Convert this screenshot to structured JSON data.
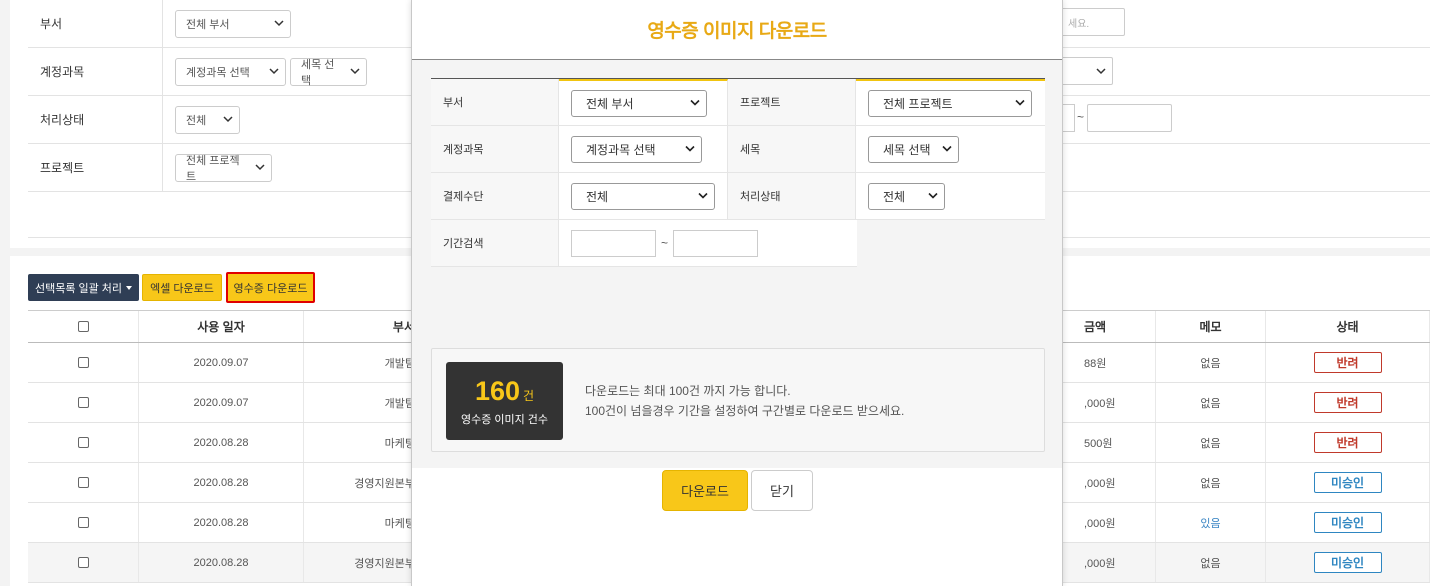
{
  "background": {
    "filters": {
      "dept": {
        "label": "부서",
        "value": "전체 부서"
      },
      "account": {
        "label": "계정과목",
        "value": "계정과목 선택",
        "detail_value": "세목 선택"
      },
      "status": {
        "label": "처리상태",
        "value": "전체"
      },
      "project": {
        "label": "프로젝트",
        "value": "전체 프로젝트"
      },
      "right_input_placeholder": "세요.",
      "tilde": "~"
    },
    "actions": {
      "batch_label": "선택목록 일괄 처리",
      "excel_label": "엑셀 다운로드",
      "receipt_label": "영수증 다운로드"
    },
    "table": {
      "headers": {
        "date": "사용 일자",
        "dept": "부서",
        "amount": "금액",
        "memo": "메모",
        "status": "상태"
      },
      "rows": [
        {
          "date": "2020.09.07",
          "dept": "개발팀",
          "amount": "88원",
          "memo": "없음",
          "status": "반려"
        },
        {
          "date": "2020.09.07",
          "dept": "개발팀",
          "amount": ",000원",
          "memo": "없음",
          "status": "반려"
        },
        {
          "date": "2020.08.28",
          "dept": "마케팅",
          "amount": "500원",
          "memo": "없음",
          "status": "반려"
        },
        {
          "date": "2020.08.28",
          "dept": "경영지원본부",
          "amount": ",000원",
          "memo": "없음",
          "status": "미승인"
        },
        {
          "date": "2020.08.28",
          "dept": "마케팅",
          "amount": ",000원",
          "memo": "있음",
          "status": "미승인"
        },
        {
          "date": "2020.08.28",
          "dept": "경영지원본부",
          "amount": ",000원",
          "memo": "없음",
          "status": "미승인"
        }
      ]
    }
  },
  "modal": {
    "title": "영수증 이미지 다운로드",
    "form": {
      "dept": {
        "label": "부서",
        "value": "전체 부서"
      },
      "project": {
        "label": "프로젝트",
        "value": "전체 프로젝트"
      },
      "account": {
        "label": "계정과목",
        "value": "계정과목 선택"
      },
      "detail": {
        "label": "세목",
        "value": "세목 선택"
      },
      "payment": {
        "label": "결제수단",
        "value": "전체"
      },
      "status": {
        "label": "처리상태",
        "value": "전체"
      },
      "period": {
        "label": "기간검색",
        "tilde": "~"
      }
    },
    "info": {
      "count": "160",
      "count_unit": "건",
      "count_label": "영수증 이미지 건수",
      "line1": "다운로드는 최대 100건 까지 가능 합니다.",
      "line2": "100건이 넘을경우 기간을 설정하여 구간별로 다운로드 받으세요."
    },
    "buttons": {
      "download": "다운로드",
      "close": "닫기"
    }
  },
  "colors": {
    "accent": "#f8c719",
    "title": "#e8a915",
    "dark_button": "#2f3e55",
    "reject": "#c0392b",
    "pending": "#2e86c1",
    "highlight_border": "#e00000"
  }
}
